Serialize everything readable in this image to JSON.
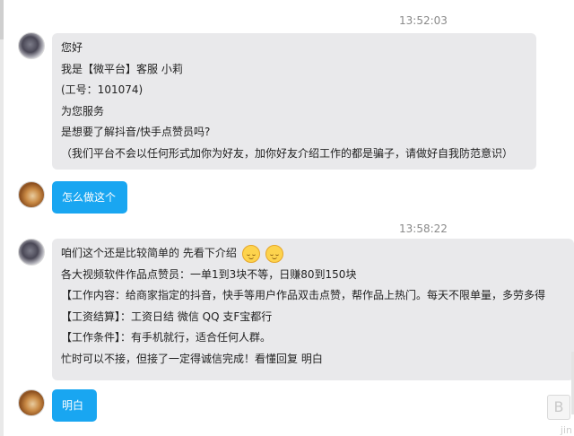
{
  "messages": [
    {
      "time": "13:52:03",
      "sender": "agent",
      "lines": [
        "您好",
        "我是【微平台】客服 小莉",
        "(工号：101074)",
        "为您服务",
        "是想要了解抖音/快手点赞员吗?",
        "（我们平台不会以任何形式加你为好友，加你好友介绍工作的都是骗子，请做好自我防范意识）"
      ]
    },
    {
      "sender": "user",
      "text": "怎么做这个"
    },
    {
      "time": "13:58:22",
      "sender": "agent",
      "lines": [
        "咱们这个还是比较简单的 先看下介绍",
        "各大视频软件作品点赞员：一单1到3块不等，日赚80到150块",
        "【工作内容：给商家指定的抖音，快手等用户作品双击点赞，帮作品上热门。每天不限单量，多劳多得",
        "【工资结算】：工资日结 微信 QQ 支F宝都行",
        "【工作条件】：有手机就行，适合任何人群。",
        "忙时可以不接，但接了一定得诚信完成！看懂回复 明白"
      ],
      "emoji": [
        "relieved-face-icon",
        "relieved-face-icon"
      ]
    },
    {
      "sender": "user",
      "text": "明白"
    }
  ],
  "colors": {
    "agent_bubble": "#e9e9eb",
    "user_bubble": "#19a6f1",
    "timestamp": "#8a8a8a"
  },
  "watermark": {
    "glyph": "B",
    "text": "jin"
  }
}
